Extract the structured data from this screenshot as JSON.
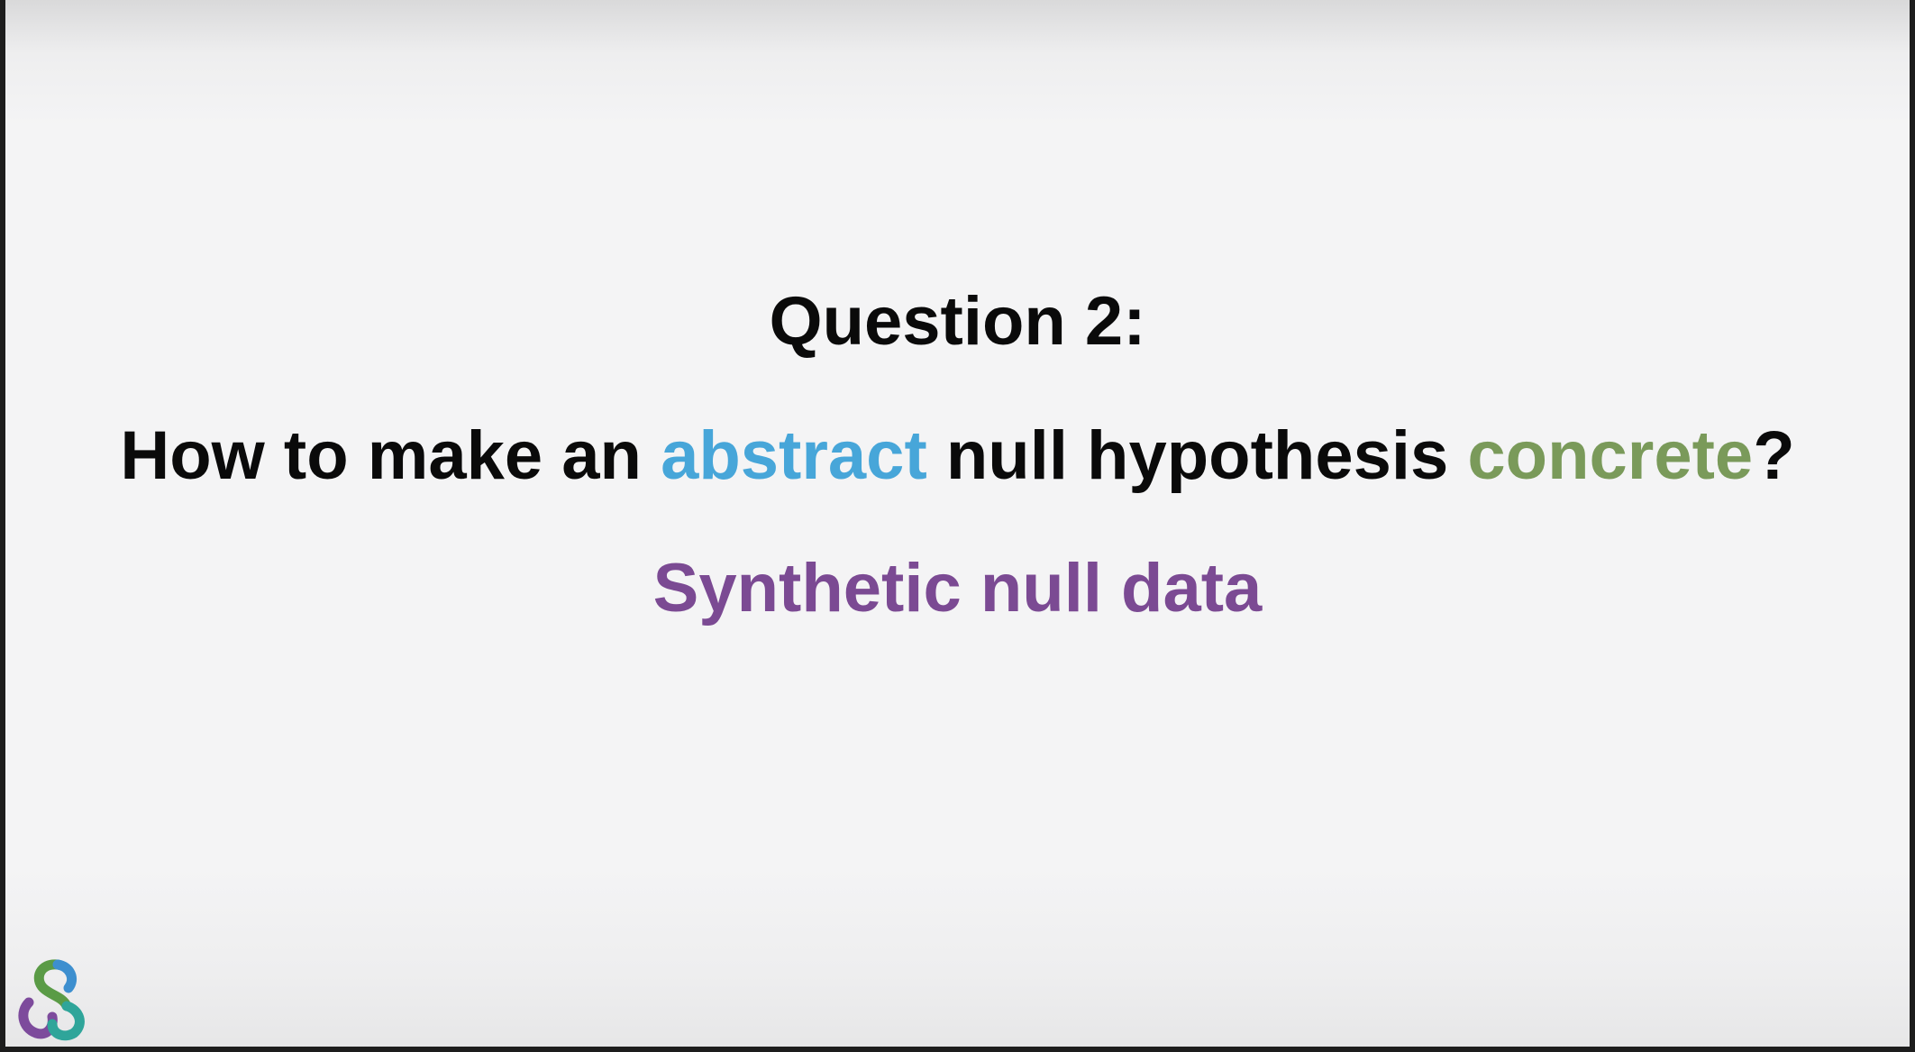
{
  "colors": {
    "text": "#0a0a0a",
    "abstract": "#47a6d9",
    "concrete": "#7a9a5a",
    "answer": "#7b4a93",
    "logo_green": "#5a9b46",
    "logo_blue": "#3d8fcf",
    "logo_purple": "#7d4b9c",
    "logo_teal": "#2fa59a"
  },
  "slide": {
    "title": "Question 2:",
    "question": {
      "part1": "How to make an ",
      "abstract_word": "abstract",
      "part2": " null hypothesis ",
      "concrete_word": "concrete",
      "part3": "?"
    },
    "answer": "Synthetic null data"
  },
  "logo": {
    "icon": "interlocking-loops-logo-icon"
  }
}
